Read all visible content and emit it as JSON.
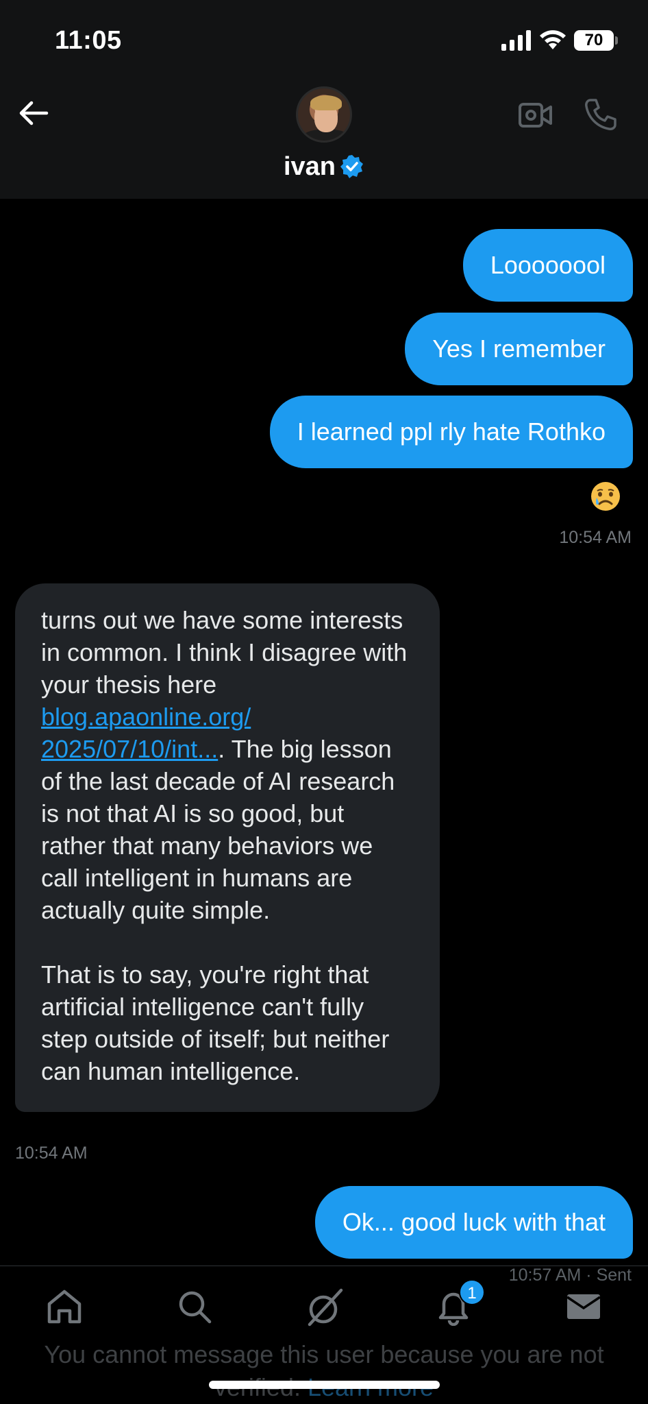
{
  "status_bar": {
    "time": "11:05",
    "battery": "70"
  },
  "header": {
    "name": "ivan",
    "verified": true
  },
  "messages": {
    "m1": {
      "text": "Loooooool"
    },
    "m2": {
      "text": "Yes I remember"
    },
    "m3": {
      "text": "I learned ppl rly hate Rothko",
      "reaction": "😢"
    },
    "group1_time": "10:54 AM",
    "incoming": {
      "line_intro": "turns out we have some interests in common. I think I disagree with your thesis here ",
      "link": "blog.apaonline.org/ 2025/07/10/int...",
      "para1_rest": ". The big lesson of the last decade of AI research is not that AI is so good, but rather that many behaviors we call intelligent in humans are actually quite simple.",
      "para2": "That is to say, you're right that artificial intelligence can't fully step outside of itself; but neither can human intelligence.",
      "time": "10:54 AM"
    },
    "m4": {
      "text": "Ok... good luck with that",
      "time": "10:57 AM",
      "status": "· Sent"
    }
  },
  "tabbar": {
    "items": [
      "home-icon",
      "search-icon",
      "grok-icon",
      "bell-icon",
      "mail-icon"
    ],
    "notification_count": "1"
  },
  "composer_notice": {
    "text": "You cannot message this user because you are not verified. ",
    "link": "Learn more"
  },
  "colors": {
    "accent": "#1d9bf0",
    "incoming_bubble": "#202327",
    "background": "#000000"
  }
}
